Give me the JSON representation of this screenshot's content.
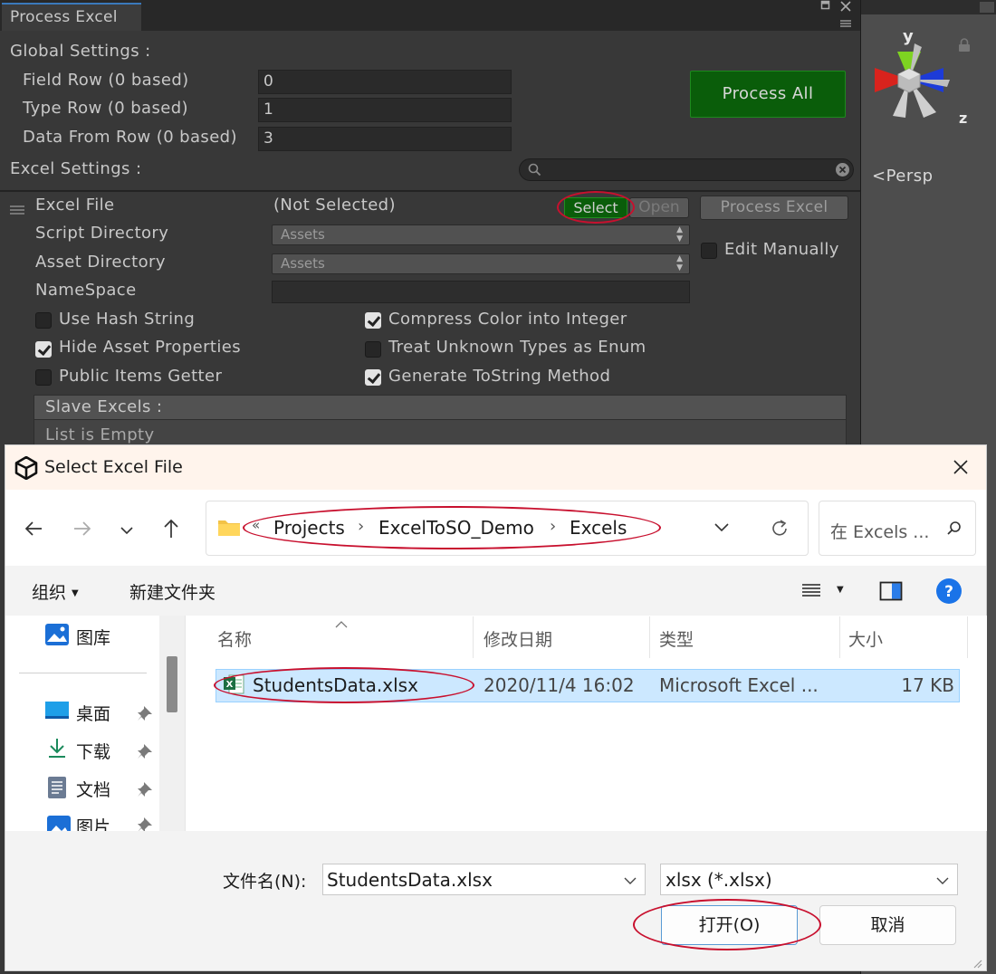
{
  "unity": {
    "tab_title": "Process Excel",
    "global_settings_label": "Global Settings :",
    "field_row_label": "Field Row (0 based)",
    "field_row_value": "0",
    "type_row_label": "Type Row (0 based)",
    "type_row_value": "1",
    "data_from_row_label": "Data From Row (0 based)",
    "data_from_row_value": "3",
    "process_all_label": "Process All",
    "excel_settings_label": "Excel Settings :",
    "excel_file_label": "Excel File",
    "excel_file_value": "(Not Selected)",
    "select_label": "Select",
    "open_label": "Open",
    "process_excel_label": "Process Excel",
    "script_directory_label": "Script Directory",
    "script_directory_value": "Assets",
    "asset_directory_label": "Asset Directory",
    "asset_directory_value": "Assets",
    "namespace_label": "NameSpace",
    "namespace_value": "",
    "edit_manually_label": "Edit Manually",
    "options": [
      {
        "label": "Use Hash String",
        "checked": false
      },
      {
        "label": "Hide Asset Properties",
        "checked": true
      },
      {
        "label": "Public Items Getter",
        "checked": false
      },
      {
        "label": "Compress Color into Integer",
        "checked": true
      },
      {
        "label": "Treat Unknown Types as Enum",
        "checked": false
      },
      {
        "label": "Generate ToString Method",
        "checked": true
      }
    ],
    "edit_manually_checked": false,
    "slave_excels_label": "Slave Excels :",
    "list_empty_label": "List is Empty",
    "accent_green": "#0a5d0a"
  },
  "scene": {
    "persp_label": "Persp",
    "axis_y": "y",
    "axis_z": "z"
  },
  "dialog": {
    "title": "Select Excel File",
    "breadcrumb": [
      "Projects",
      "ExcelToSO_Demo",
      "Excels"
    ],
    "breadcrumb_overflow": "«",
    "search_placeholder": "在 Excels ...",
    "organize_label": "组织",
    "new_folder_label": "新建文件夹",
    "nav_items": [
      {
        "label": "图库",
        "pinned": false
      },
      {
        "label": "桌面",
        "pinned": true
      },
      {
        "label": "下载",
        "pinned": true
      },
      {
        "label": "文档",
        "pinned": true
      },
      {
        "label": "图片",
        "pinned": true
      }
    ],
    "columns": [
      "名称",
      "修改日期",
      "类型",
      "大小"
    ],
    "files": [
      {
        "name": "StudentsData.xlsx",
        "modified": "2020/11/4 16:02",
        "type": "Microsoft Excel ...",
        "size": "17 KB"
      }
    ],
    "filename_label": "文件名(N):",
    "filename_value": "StudentsData.xlsx",
    "filetype_value": "xlsx (*.xlsx)",
    "open_button": "打开(O)",
    "cancel_button": "取消",
    "highlight_color": "#c8102e"
  }
}
